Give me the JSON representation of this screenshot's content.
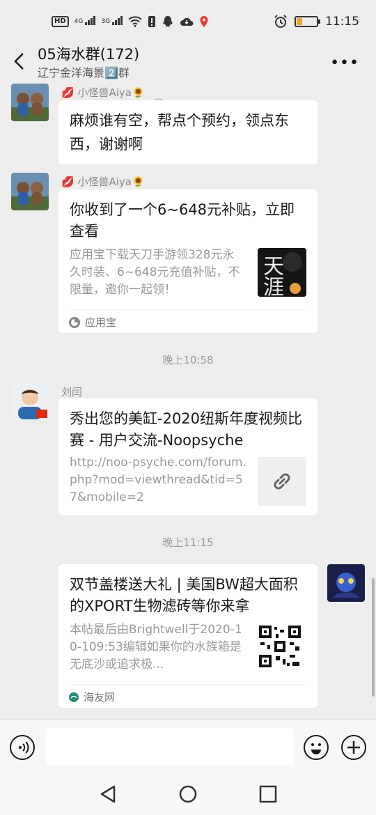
{
  "status_bar": {
    "hd": "HD",
    "signal1": "4G",
    "signal2": "3G",
    "time": "11:15",
    "battery_level": 0.25,
    "battery_color": "#f5a623"
  },
  "header": {
    "title": "05海水群(172)",
    "subtitle": "辽宁金洋海景2️⃣群",
    "back_icon": "chevron-left-icon",
    "mute_icon": "bell-off-icon",
    "more_icon": "more-dots-icon",
    "more_label": "•••"
  },
  "messages": [
    {
      "sender": "小怪兽Aiya🌻",
      "text": "麻烦谁有空，帮点个预约，领点东西，谢谢啊"
    },
    {
      "sender": "小怪兽Aiya🌻",
      "card_title": "你收到了一个6~648元补贴，立即查看",
      "card_desc": "应用宝下载天刀手游领328元永久时装、6~648元充值补贴，不限量，邀你一起领！",
      "card_source": "应用宝",
      "thumb_text": "天涯"
    },
    {
      "timestamp": "晚上10:58"
    },
    {
      "sender": "刘闫",
      "card_title": "秀出您的美缸-2020纽斯年度视频比赛 - 用户交流-Noopsyche",
      "card_desc": "http://noo-psyche.com/forum.php?mod=viewthread&tid=57&mobile=2",
      "thumb_icon": "link-icon"
    },
    {
      "timestamp": "晚上11:15"
    },
    {
      "card_title": "双节盖楼送大礼 | 美国BW超大面积的XPORT生物滤砖等你来拿",
      "card_desc": "本帖最后由Brightwell于2020-10-109:53编辑如果你的水族箱是无底沙或追求极...",
      "card_source": "海友网",
      "thumb_icon": "qr-code-icon"
    }
  ],
  "input_bar": {
    "voice_icon": "voice-icon",
    "emoji_icon": "emoji-icon",
    "add_icon": "add-icon",
    "placeholder": ""
  },
  "nav_bar": {
    "back_icon": "nav-back-icon",
    "home_icon": "nav-home-icon",
    "recents_icon": "nav-recents-icon"
  }
}
